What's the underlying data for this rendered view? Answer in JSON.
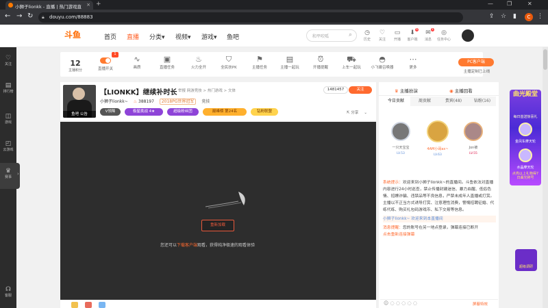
{
  "browser": {
    "tab_title": "小狮子lionkk - 直播 | 热门游戏直",
    "url": "douyu.com/88883",
    "avatar_letter": "C"
  },
  "header": {
    "logo": "斗鱼",
    "nav": [
      "首页",
      "直播",
      "分类▾",
      "视频▾",
      "游戏▾",
      "鱼吧"
    ],
    "active_nav": "直播",
    "search_placeholder": "和平吹呱",
    "icons": [
      {
        "icon": "clock-icon",
        "label": "历史"
      },
      {
        "icon": "heart-icon",
        "label": "关注"
      },
      {
        "icon": "broadcast-icon",
        "label": "开播"
      },
      {
        "icon": "download-icon",
        "label": "客户端",
        "badge": "6"
      },
      {
        "icon": "message-icon",
        "label": "消息",
        "badge": "1"
      },
      {
        "icon": "task-icon",
        "label": "任务中心"
      }
    ]
  },
  "sidebar": {
    "items": [
      {
        "icon": "heart-icon",
        "label": "关注"
      },
      {
        "icon": "ranking-icon",
        "label": "排行榜"
      },
      {
        "icon": "game-icon",
        "label": "游戏"
      },
      {
        "icon": "cloud-game-icon",
        "label": "云游戏"
      },
      {
        "icon": "trophy-icon",
        "label": "赛事"
      },
      {
        "icon": "headset-icon",
        "label": "客服"
      }
    ]
  },
  "tools": {
    "level": "12",
    "level_label": "主播积分",
    "new_badge": "1",
    "items": [
      "直播开关",
      "画质",
      "直播任务",
      "火力全开",
      "全民扶PK",
      "主播任务",
      "主播一起玩",
      "开播提醒",
      "上车一起玩",
      "小飞碟召唤器",
      "更多"
    ],
    "pc_button": "PC客户端",
    "pc_sub": "主播定制已上线"
  },
  "streamer": {
    "title": "【LIONKK】继续补时长",
    "category": "举报  网游竞技 > 热门游戏 > 文体",
    "host_name": "小狮子lionkk~",
    "fans": "388197",
    "tag_badge": "2018PG世界冠军",
    "rank_label": "竞技",
    "avatar_caption": "鱼吧  公告",
    "views": "1481457",
    "follow_label": "关注",
    "pills": [
      "V领降",
      "极星挑战  4★",
      "超级粉丝团",
      "巅峰榜  第24名",
      "钻粉联盟"
    ],
    "share_label": "分享"
  },
  "player": {
    "reload_label": "重新加载",
    "hint_pre": "您还可以",
    "hint_link": "下载客户端",
    "hint_post": "观看，获得纯净极速的观看体验"
  },
  "chat": {
    "tab_header_left": "主播扮演",
    "tab_header_right": "主播回看",
    "tabs": [
      "今日贡献",
      "周贡献",
      "贵宾(48)",
      "钻粉(16)"
    ],
    "ranking": [
      {
        "name": "一只天宝宝",
        "level": "LV.53"
      },
      {
        "name": "4AM小哥ax~",
        "level": "LV.63"
      },
      {
        "name": "Jon被",
        "level": "LV.55"
      }
    ],
    "system_label": "系统提示：",
    "system_msg": "欢迎来到小狮子lionkk~的直播间。斗鱼依法对直播内容进行24小时巡查，禁止传播封建迷信、暴力血腥、低俗色情、招嫖诈骗、违禁品等不良信息，严禁未成年人直播或打赏。主播以不正当方式诱导打赏、注意理性消费，警惕招聘征婚、代练代练、购买礼包码游戏币、私下交易等信息。",
    "welcome": "小狮子lionkk~ 欢迎来到本直播间",
    "notice_label": "消息提醒：",
    "notice_msg": "您的账号在另一地点登录，弹幕连接已断开",
    "notice_link": "点击重新连接弹幕",
    "settings_label": "屏蔽特效"
  },
  "ad": {
    "title": "曲光殿堂",
    "sub": "每日首送惊喜礼",
    "gift1": "金凤车摩天轮",
    "gift2": "水晶摩天轮",
    "bottom": "点亮以上礼物得7日曲光称号"
  },
  "side_badge": "超级调研"
}
